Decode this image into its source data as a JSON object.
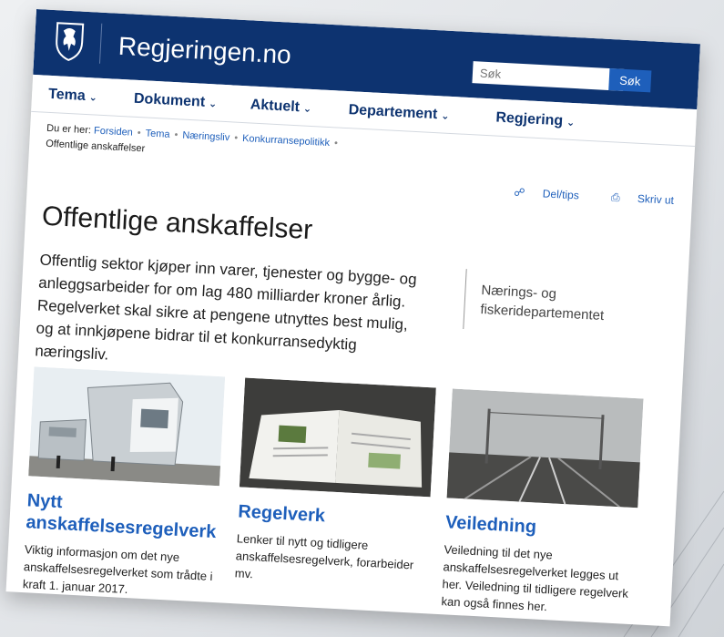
{
  "site": {
    "name": "Regjeringen.no"
  },
  "search": {
    "placeholder": "Søk",
    "button_label": "Søk"
  },
  "nav": {
    "items": [
      "Tema",
      "Dokument",
      "Aktuelt",
      "Departement",
      "Regjering"
    ]
  },
  "breadcrumb": {
    "prefix": "Du er her:",
    "links": [
      "Forsiden",
      "Tema",
      "Næringsliv",
      "Konkurransepolitikk"
    ],
    "current": "Offentlige anskaffelser"
  },
  "actions": {
    "share": "Del/tips",
    "print": "Skriv ut"
  },
  "main": {
    "title": "Offentlige anskaffelser",
    "intro": "Offentlig sektor kjøper inn varer, tjenester og bygge- og anleggsarbeider for om lag 480 milliarder kroner årlig. Regelverket skal sikre at pengene utnyttes best mulig, og at innkjøpene bidrar til et konkurransedyktig næringsliv."
  },
  "side": {
    "department": "Nærings- og fiskeridepartementet"
  },
  "cards": [
    {
      "title": "Nytt anskaffelsesregelverk",
      "description": "Viktig informasjon om det nye anskaffelsesregelverket som trådte i kraft 1. januar 2017."
    },
    {
      "title": "Regelverk",
      "description": "Lenker til nytt og tidligere anskaffelsesregelverk, forarbeider mv."
    },
    {
      "title": "Veiledning",
      "description": "Veiledning til det nye anskaffelsesregelverket legges ut her. Veiledning til tidligere regelverk kan også finnes her."
    }
  ],
  "colors": {
    "header": "#0d3370",
    "link": "#1e5fbb",
    "search_button": "#1e5fbb"
  },
  "icons": [
    "coat-of-arms-logo",
    "share-icon",
    "print-icon",
    "chevron-down-icon"
  ]
}
